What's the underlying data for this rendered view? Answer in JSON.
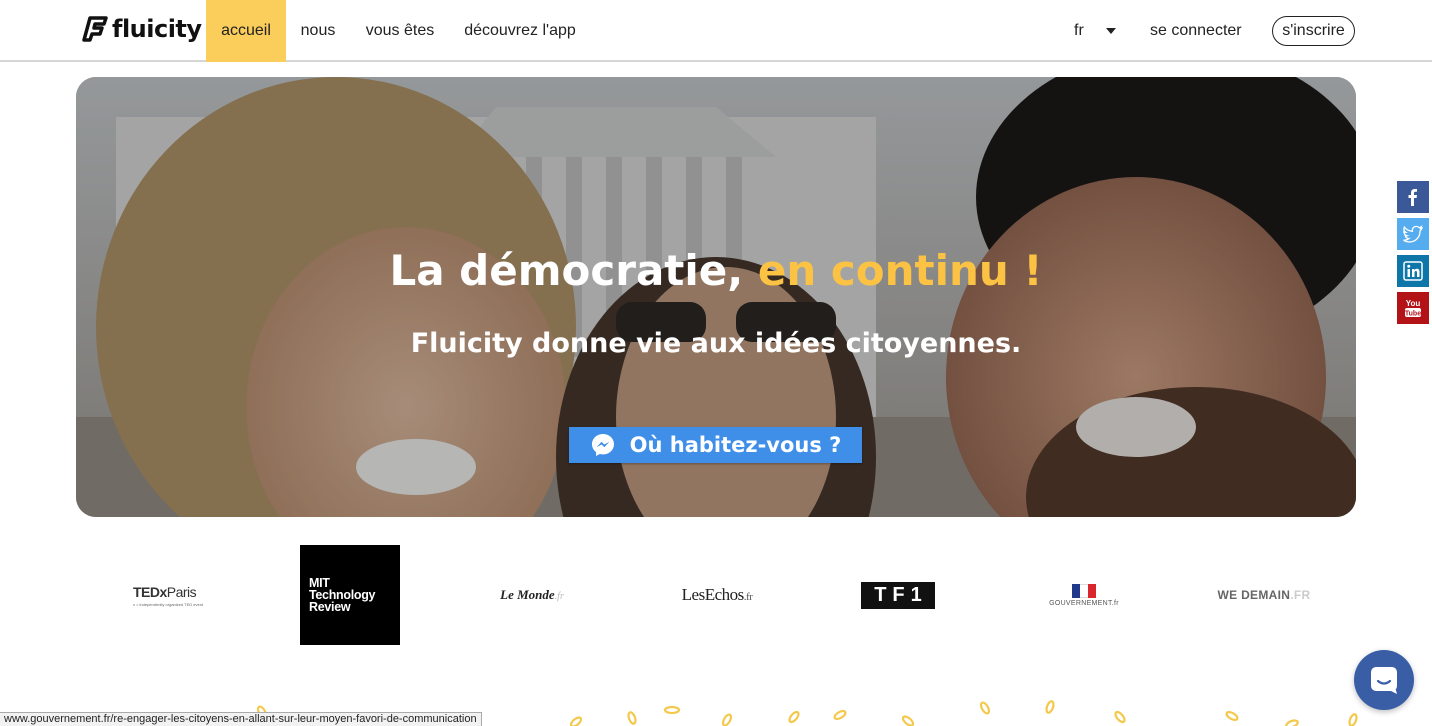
{
  "nav": {
    "logo_text": "fluicity",
    "items": [
      {
        "label": "accueil"
      },
      {
        "label": "nous"
      },
      {
        "label": "vous êtes"
      },
      {
        "label": "découvrez l'app"
      }
    ],
    "language": "fr",
    "login_label": "se connecter",
    "signup_label": "s'inscrire"
  },
  "hero": {
    "title": "La démocratie,",
    "title_accent": "en continu !",
    "subtitle": "Fluicity donne vie aux idées citoyennes.",
    "cta_label": "Où habitez-vous ?"
  },
  "social": [
    "facebook-icon",
    "twitter-icon",
    "linkedin-icon",
    "youtube-icon"
  ],
  "press": {
    "ted": {
      "name": "TEDx",
      "city": "Paris",
      "tagline": "x = independently organized TED event"
    },
    "mit": [
      "MIT",
      "Technology",
      "Review"
    ],
    "lemonde": {
      "name": "Le Monde",
      "suffix": ".fr"
    },
    "lesechos": {
      "name": "LesEchos",
      "suffix": ".fr"
    },
    "tf1": "TF1",
    "gouv": "GOUVERNEMENT.fr",
    "wedemain": {
      "name": "WE DEMAIN",
      "suffix": ".FR"
    }
  },
  "status_url": "www.gouvernement.fr/re-engager-les-citoyens-en-allant-sur-leur-moyen-favori-de-communication",
  "colors": {
    "accent": "#fbcd5a",
    "title_accent": "#fbc244",
    "cta": "#3f8fe8",
    "chat": "#3a5ea6"
  }
}
